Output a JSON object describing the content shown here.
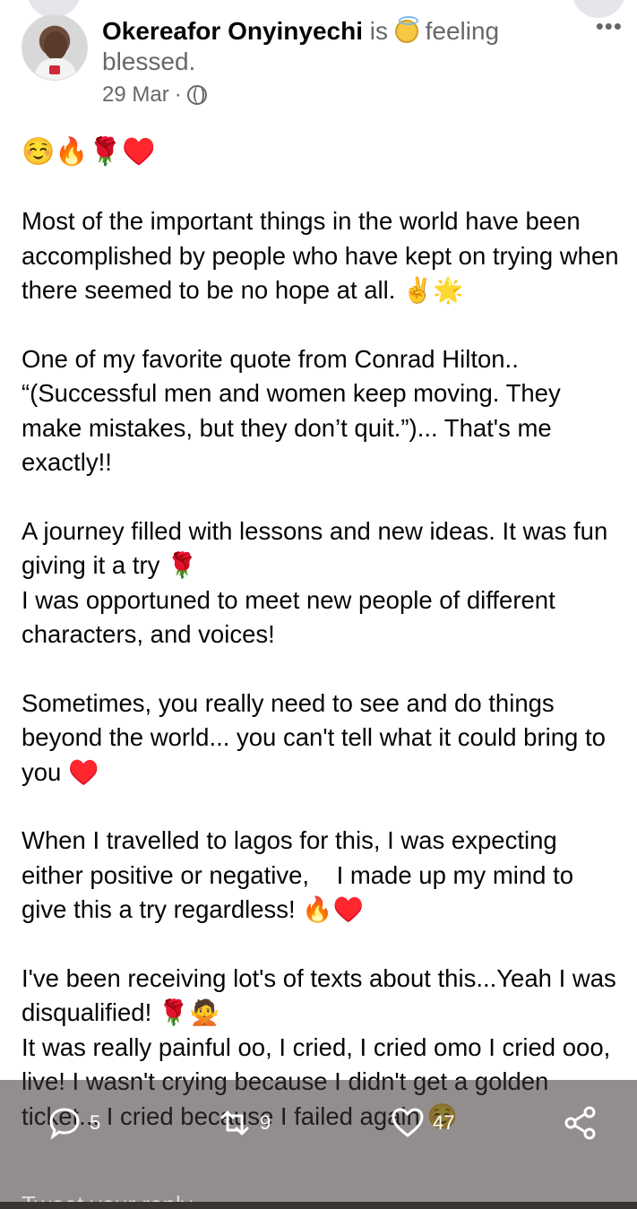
{
  "post": {
    "author": "Okereafor Onyinyechi",
    "is_text": "is",
    "feeling_text": "feeling blessed.",
    "date": "29 Mar",
    "separator": "·",
    "more_label": "•••",
    "body_paragraphs": [
      "☺️🔥🌹♥️",
      "Most of the important things in the world have been accomplished by people who have kept on trying when there seemed to be no hope at all. ✌️🌟",
      "One of my favorite quote from Conrad Hilton..\n“(Successful men and women keep moving. They make mistakes, but they don’t quit.”)... That's me exactly!!",
      "A journey filled with lessons and new ideas. It was fun giving it a try 🌹\nI was opportuned to meet new people of different characters, and voices!",
      "Sometimes, you really need to see and do things beyond the world... you can't tell what it could bring to you ♥️",
      "When I travelled to lagos for this, I was expecting either positive or negative,    I made up my mind to give this a try regardless! 🔥♥️",
      "I've been receiving lot's of texts about this...Yeah I was disqualified! 🌹🙅\nIt was really painful oo, I cried, I cried omo I cried ooo, live! I wasn't crying because I didn't get a golden ticket... I cried because I failed again ☺️"
    ]
  },
  "actions": {
    "reply_count": "5",
    "retweet_count": "9",
    "like_count": "47",
    "reply_icon": "comment-icon",
    "retweet_icon": "retweet-icon",
    "like_icon": "heart-icon",
    "share_icon": "share-icon"
  },
  "reply_placeholder": "Tweet your reply",
  "colors": {
    "overlay": "#37302f",
    "text": "#050505",
    "meta": "#65676b"
  }
}
